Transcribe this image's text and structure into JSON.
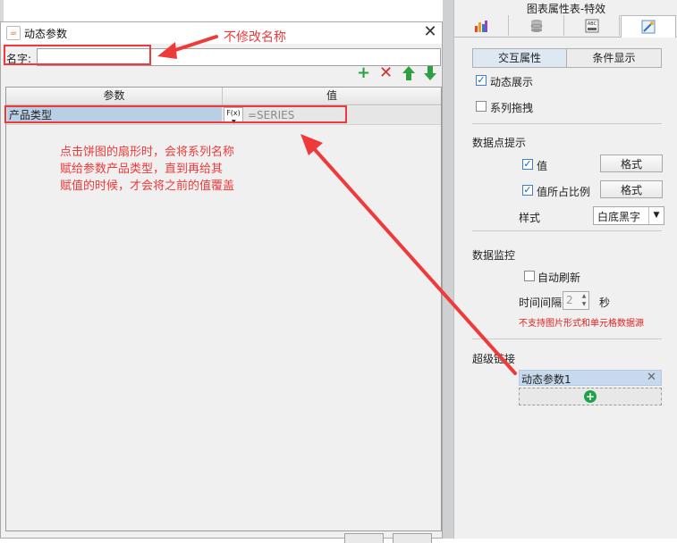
{
  "dialog": {
    "title": "动态参数",
    "name_label": "名字:",
    "name_value": "",
    "toolbar": {
      "add": "+",
      "delete": "✕",
      "up": "⬆",
      "down": "⬇"
    },
    "table": {
      "headers": [
        "参数",
        "值"
      ],
      "rows": [
        {
          "param": "产品类型",
          "fx": "F(x)",
          "value": "=SERIES"
        }
      ]
    }
  },
  "panel": {
    "title": "图表属性表-特效",
    "tabs": [
      "chart-type-icon",
      "data-icon",
      "style-icon",
      "effect-icon"
    ],
    "sub_tabs": {
      "interactive": "交互属性",
      "conditional": "条件显示"
    },
    "dynamic_display": {
      "label": "动态展示",
      "checked": true
    },
    "series_drag": {
      "label": "系列拖拽",
      "checked": false
    },
    "tooltip": {
      "title": "数据点提示",
      "value": {
        "label": "值",
        "checked": true,
        "button": "格式"
      },
      "ratio": {
        "label": "值所占比例",
        "checked": true,
        "button": "格式"
      },
      "style_label": "样式",
      "style_value": "白底黑字"
    },
    "monitor": {
      "title": "数据监控",
      "auto_refresh": {
        "label": "自动刷新",
        "checked": false
      },
      "interval_label": "时间间隔",
      "interval_value": "2",
      "interval_unit": "秒",
      "warning": "不支持图片形式和单元格数据源"
    },
    "hyperlink": {
      "title": "超级链接",
      "items": [
        "动态参数1"
      ]
    }
  },
  "annotations": {
    "name_note": "不修改名称",
    "body_note": [
      "点击饼图的扇形时，会将系列名称",
      "赋给参数产品类型，直到再给其",
      "赋值的时候，才会将之前的值覆盖"
    ],
    "color": "#ee3a3a"
  }
}
